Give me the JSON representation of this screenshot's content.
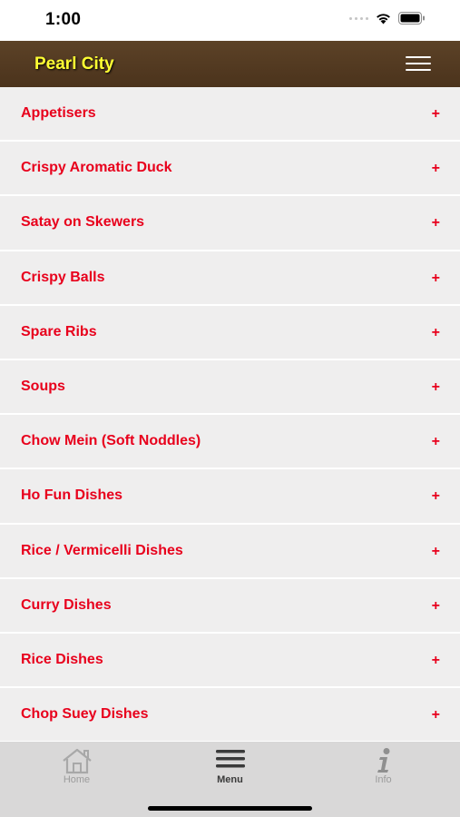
{
  "status_bar": {
    "time": "1:00"
  },
  "header": {
    "title": "Pearl City",
    "menu_icon": "hamburger-icon"
  },
  "menu": {
    "expand_symbol": "+",
    "items": [
      {
        "label": "Appetisers"
      },
      {
        "label": "Crispy Aromatic Duck"
      },
      {
        "label": "Satay on Skewers"
      },
      {
        "label": "Crispy Balls"
      },
      {
        "label": "Spare Ribs"
      },
      {
        "label": "Soups"
      },
      {
        "label": "Chow Mein (Soft Noddles)"
      },
      {
        "label": "Ho Fun Dishes"
      },
      {
        "label": "Rice / Vermicelli Dishes"
      },
      {
        "label": "Curry Dishes"
      },
      {
        "label": "Rice Dishes"
      },
      {
        "label": "Chop Suey Dishes"
      }
    ]
  },
  "tab_bar": {
    "tabs": [
      {
        "label": "Home",
        "icon": "home-icon",
        "active": false
      },
      {
        "label": "Menu",
        "icon": "menu-icon",
        "active": true
      },
      {
        "label": "Info",
        "icon": "info-icon",
        "active": false
      }
    ]
  },
  "colors": {
    "header_bg": "#503720",
    "title": "#ffff33",
    "item_text": "#e8001c",
    "item_bg": "#efeeee",
    "tab_bar_bg": "#d9d8d8"
  }
}
